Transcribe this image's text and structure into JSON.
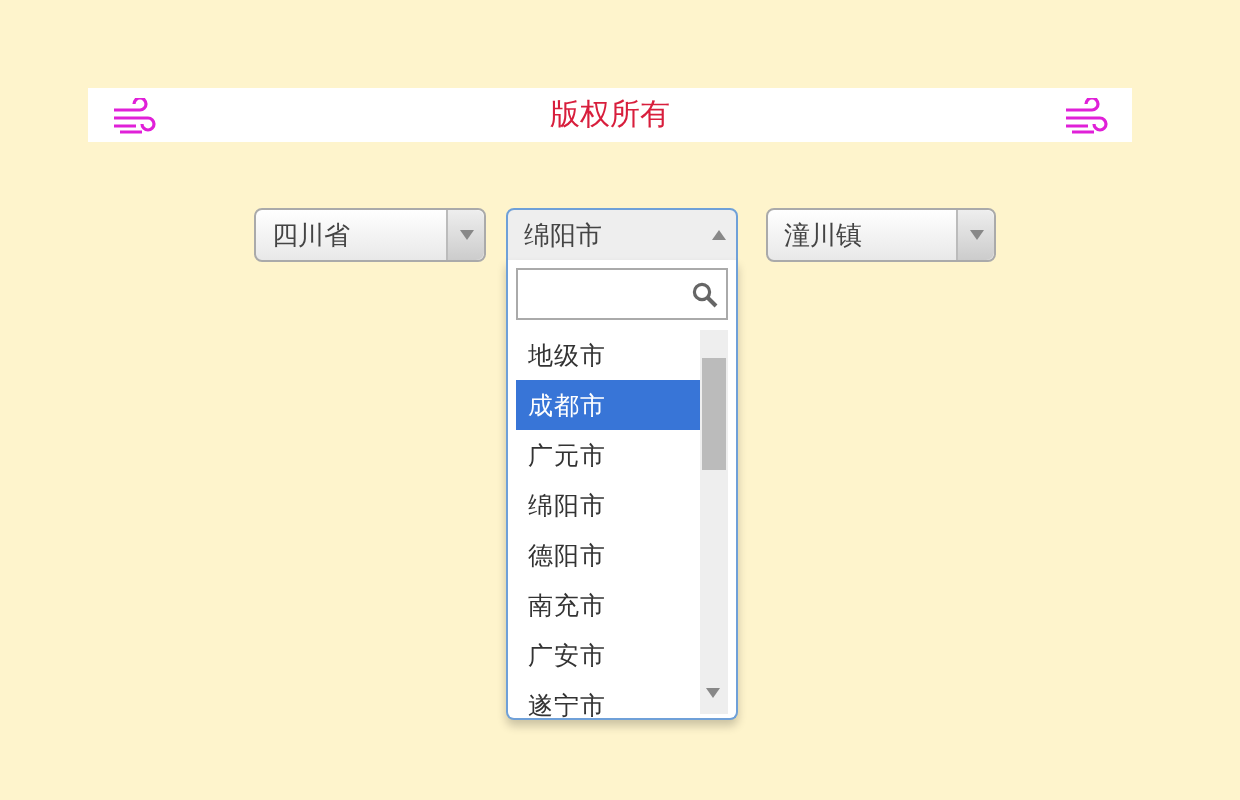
{
  "banner": {
    "title": "版权所有"
  },
  "selects": [
    {
      "value": "四川省",
      "expanded": false
    },
    {
      "value": "绵阳市",
      "expanded": true,
      "searchable": true,
      "options": [
        {
          "label": "地级市",
          "highlighted": false
        },
        {
          "label": "成都市",
          "highlighted": true
        },
        {
          "label": "广元市",
          "highlighted": false
        },
        {
          "label": "绵阳市",
          "highlighted": false
        },
        {
          "label": "德阳市",
          "highlighted": false
        },
        {
          "label": "南充市",
          "highlighted": false
        },
        {
          "label": "广安市",
          "highlighted": false
        },
        {
          "label": "遂宁市",
          "highlighted": false
        }
      ]
    },
    {
      "value": "潼川镇",
      "expanded": false
    }
  ]
}
